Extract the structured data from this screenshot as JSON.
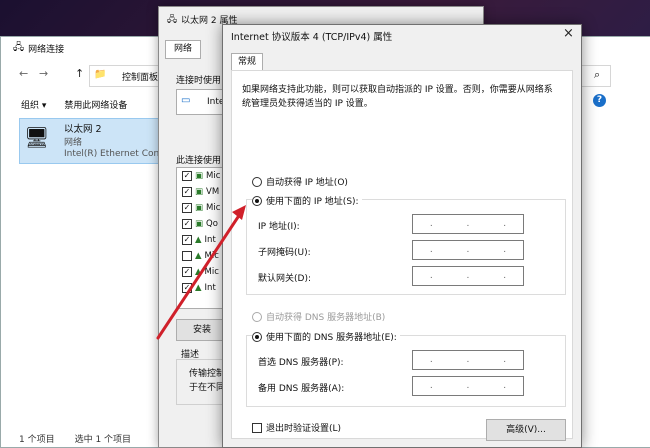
{
  "netwin": {
    "title": "网络连接",
    "nav": [
      "←",
      "→",
      "↑"
    ],
    "address": "控制面板",
    "toolbar": [
      "组织 ▾",
      "禁用此网络设备"
    ],
    "adapter": {
      "name": "以太网 2",
      "status": "网络",
      "device": "Intel(R) Ethernet Conn"
    },
    "status": [
      "1 个项目",
      "选中 1 个项目"
    ]
  },
  "ethwin": {
    "title": "以太网 2 属性",
    "tab": "网络",
    "connect_using": "连接时使用:",
    "adapter_short": "Inte",
    "uses_label": "此连接使用",
    "items": [
      "Mic",
      "VM",
      "Mic",
      "Qo",
      "Int",
      "Mic",
      "Mic",
      "Int"
    ],
    "install": "安装",
    "desc_label": "描述",
    "desc_text1": "传输控制",
    "desc_text2": "于在不同"
  },
  "tcp": {
    "title": "Internet 协议版本 4 (TCP/IPv4) 属性",
    "close": "×",
    "tab": "常规",
    "desc": "如果网络支持此功能，则可以获取自动指派的 IP 设置。否则，你需要从网络系统管理员处获得适当的 IP 设置。",
    "auto_ip": "自动获得 IP 地址(O)",
    "manual_ip": "使用下面的 IP 地址(S):",
    "ip_label": "IP 地址(I):",
    "mask_label": "子网掩码(U):",
    "gateway_label": "默认网关(D):",
    "auto_dns": "自动获得 DNS 服务器地址(B)",
    "manual_dns": "使用下面的 DNS 服务器地址(E):",
    "pref_dns": "首选 DNS 服务器(P):",
    "alt_dns": "备用 DNS 服务器(A):",
    "validate": "退出时验证设置(L)",
    "advanced": "高级(V)..."
  },
  "colors": {
    "arrow": "#d0202a",
    "selection": "#cce4f7"
  }
}
